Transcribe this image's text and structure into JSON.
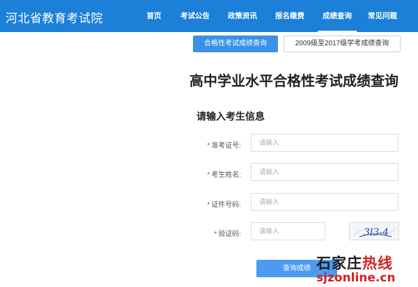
{
  "header": {
    "site_title": "河北省教育考试院",
    "nav": [
      {
        "label": "首页"
      },
      {
        "label": "考试公告"
      },
      {
        "label": "政策资讯"
      },
      {
        "label": "报名缴费"
      },
      {
        "label": "成绩查询",
        "active": true
      },
      {
        "label": "常见问题"
      }
    ],
    "bg_color": "#1c7fd8"
  },
  "tabs": {
    "primary": "合格性考试成绩查询",
    "secondary": "2009级至2017级学考成绩查询"
  },
  "page_title": "高中学业水平合格性考试成绩查询",
  "section_title": "请输入考生信息",
  "form": {
    "required_mark": "*",
    "fields": [
      {
        "label": "准考证号:",
        "placeholder": "请输入"
      },
      {
        "label": "考生姓名:",
        "placeholder": "请输入"
      },
      {
        "label": "证件号码:",
        "placeholder": "请输入"
      },
      {
        "label": "验证码:",
        "placeholder": "请输入"
      }
    ],
    "captcha_text": "3l3-4",
    "submit_label": "查询成绩"
  },
  "watermark": {
    "line1_a": "石家庄",
    "line1_b": "热线",
    "line2": "sjzonline.cn"
  }
}
